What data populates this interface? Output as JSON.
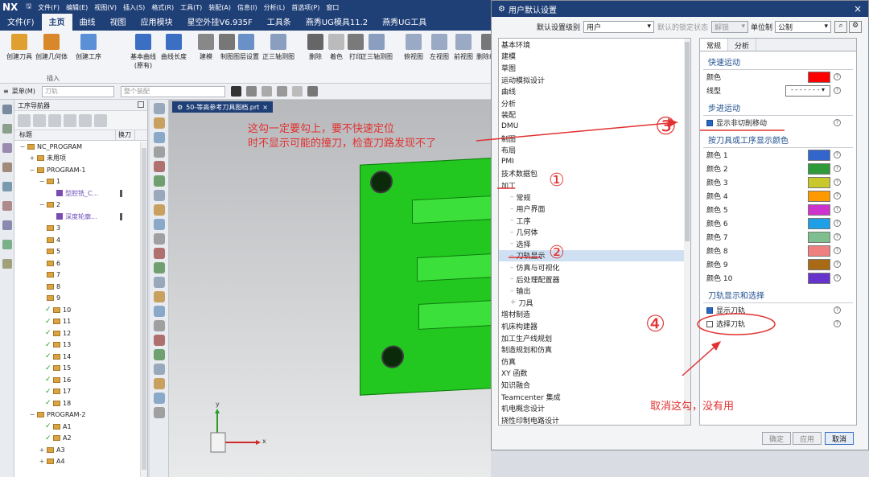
{
  "app": {
    "logo": "NX"
  },
  "menu": [
    "文件(F)",
    "编辑(E)",
    "视图(V)",
    "插入(S)",
    "格式(R)",
    "工具(T)",
    "装配(A)",
    "信息(I)",
    "分析(L)",
    "首选项(P)",
    "窗口"
  ],
  "tabs": [
    {
      "label": "文件(F)",
      "active": false
    },
    {
      "label": "主页",
      "active": true
    },
    {
      "label": "曲线",
      "active": false
    },
    {
      "label": "视图",
      "active": false
    },
    {
      "label": "应用模块",
      "active": false
    },
    {
      "label": "星空外挂V6.935F",
      "active": false
    },
    {
      "label": "工具条",
      "active": false
    },
    {
      "label": "燕秀UG模具11.2",
      "active": false
    },
    {
      "label": "燕秀UG工具",
      "active": false
    }
  ],
  "ribbon": {
    "buttons": [
      "创建刀具",
      "创建几何体",
      "创建工序",
      "基本曲线\n(原有)",
      "曲线长度",
      "建模",
      "制图",
      "图层设置",
      "正三轴测图",
      "删除",
      "着色",
      "打印",
      "正三轴测图",
      "俯视图",
      "左视图",
      "前视图",
      "删除组件"
    ],
    "group_label": "插入"
  },
  "toolbar2": {
    "menu_label": "菜单(M)",
    "filter_placeholder": "刀轨",
    "assembly_placeholder": "整个装配"
  },
  "navigator": {
    "title": "工序导航器",
    "columns": [
      "标题",
      "换刀"
    ],
    "rows": [
      {
        "indent": 0,
        "exp": "−",
        "icon": "folder",
        "label": "NC_PROGRAM",
        "mark": ""
      },
      {
        "indent": 1,
        "exp": "+",
        "icon": "folder",
        "label": "未用项",
        "mark": ""
      },
      {
        "indent": 1,
        "exp": "−",
        "icon": "folder",
        "label": "PROGRAM-1",
        "mark": ""
      },
      {
        "indent": 2,
        "exp": "−",
        "icon": "folder",
        "label": "1",
        "mark": ""
      },
      {
        "indent": 3,
        "exp": "",
        "icon": "op",
        "label": "型腔铣_C...",
        "mark": "tool",
        "purple": true
      },
      {
        "indent": 2,
        "exp": "−",
        "icon": "folder",
        "label": "2",
        "mark": ""
      },
      {
        "indent": 3,
        "exp": "",
        "icon": "op",
        "label": "深度轮廓...",
        "mark": "tool",
        "purple": true
      },
      {
        "indent": 2,
        "exp": "",
        "icon": "folder",
        "label": "3",
        "mark": ""
      },
      {
        "indent": 2,
        "exp": "",
        "icon": "folder",
        "label": "4",
        "mark": ""
      },
      {
        "indent": 2,
        "exp": "",
        "icon": "folder",
        "label": "5",
        "mark": ""
      },
      {
        "indent": 2,
        "exp": "",
        "icon": "folder",
        "label": "6",
        "mark": ""
      },
      {
        "indent": 2,
        "exp": "",
        "icon": "folder",
        "label": "7",
        "mark": ""
      },
      {
        "indent": 2,
        "exp": "",
        "icon": "folder",
        "label": "8",
        "mark": ""
      },
      {
        "indent": 2,
        "exp": "",
        "icon": "folder",
        "label": "9",
        "mark": ""
      },
      {
        "indent": 2,
        "exp": "",
        "icon": "folder",
        "label": "10",
        "mark": "",
        "check": true
      },
      {
        "indent": 2,
        "exp": "",
        "icon": "folder",
        "label": "11",
        "mark": "",
        "check": true
      },
      {
        "indent": 2,
        "exp": "",
        "icon": "folder",
        "label": "12",
        "mark": "",
        "check": true
      },
      {
        "indent": 2,
        "exp": "",
        "icon": "folder",
        "label": "13",
        "mark": "",
        "check": true
      },
      {
        "indent": 2,
        "exp": "",
        "icon": "folder",
        "label": "14",
        "mark": "",
        "check": true
      },
      {
        "indent": 2,
        "exp": "",
        "icon": "folder",
        "label": "15",
        "mark": "",
        "check": true
      },
      {
        "indent": 2,
        "exp": "",
        "icon": "folder",
        "label": "16",
        "mark": "",
        "check": true
      },
      {
        "indent": 2,
        "exp": "",
        "icon": "folder",
        "label": "17",
        "mark": "",
        "check": true
      },
      {
        "indent": 2,
        "exp": "",
        "icon": "folder",
        "label": "18",
        "mark": "",
        "check": true
      },
      {
        "indent": 1,
        "exp": "−",
        "icon": "folder",
        "label": "PROGRAM-2",
        "mark": ""
      },
      {
        "indent": 2,
        "exp": "",
        "icon": "folder",
        "label": "A1",
        "mark": "",
        "check": true
      },
      {
        "indent": 2,
        "exp": "",
        "icon": "folder",
        "label": "A2",
        "mark": "",
        "check": true
      },
      {
        "indent": 2,
        "exp": "+",
        "icon": "folder",
        "label": "A3",
        "mark": ""
      },
      {
        "indent": 2,
        "exp": "+",
        "icon": "folder",
        "label": "A4",
        "mark": ""
      }
    ]
  },
  "viewport": {
    "tab_label": "50-等高参考刀具图档.prt",
    "axis_y": "y",
    "axis_x": "x"
  },
  "dialog": {
    "title": "用户默认设置",
    "level_label": "默认设置级别",
    "level_value": "用户",
    "lock_label": "默认的锁定状态",
    "lock_value": "解锁",
    "unit_label": "单位制",
    "unit_value": "公制",
    "categories": [
      {
        "label": "基本环境",
        "sub": false
      },
      {
        "label": "建模",
        "sub": false
      },
      {
        "label": "草图",
        "sub": false
      },
      {
        "label": "运动模拟设计",
        "sub": false
      },
      {
        "label": "曲线",
        "sub": false
      },
      {
        "label": "分析",
        "sub": false
      },
      {
        "label": "装配",
        "sub": false
      },
      {
        "label": "DMU",
        "sub": false
      },
      {
        "label": "制图",
        "sub": false
      },
      {
        "label": "布局",
        "sub": false
      },
      {
        "label": "PMI",
        "sub": false
      },
      {
        "label": "技术数据包",
        "sub": false
      },
      {
        "label": "加工",
        "sub": false
      },
      {
        "label": "常规",
        "sub": true
      },
      {
        "label": "用户界面",
        "sub": true
      },
      {
        "label": "工序",
        "sub": true
      },
      {
        "label": "几何体",
        "sub": true
      },
      {
        "label": "选择",
        "sub": true
      },
      {
        "label": "刀轨显示",
        "sub": true,
        "selected": true
      },
      {
        "label": "仿真与可视化",
        "sub": true
      },
      {
        "label": "后处理配置器",
        "sub": true
      },
      {
        "label": "输出",
        "sub": true
      },
      {
        "label": "刀具",
        "sub": true,
        "plus": true
      },
      {
        "label": "增材制造",
        "sub": false
      },
      {
        "label": "机床构建器",
        "sub": false
      },
      {
        "label": "加工生产线规划",
        "sub": false
      },
      {
        "label": "制造规划和仿真",
        "sub": false
      },
      {
        "label": "仿真",
        "sub": false
      },
      {
        "label": "XY 函数",
        "sub": false
      },
      {
        "label": "知识融合",
        "sub": false
      },
      {
        "label": "Teamcenter 集成",
        "sub": false
      },
      {
        "label": "机电概念设计",
        "sub": false
      },
      {
        "label": "挠性印制电路设计",
        "sub": false
      }
    ],
    "panel_tabs": [
      "常规",
      "分析"
    ],
    "fast_motion": {
      "title": "快速运动",
      "color_label": "颜色",
      "color": "#ff0000",
      "linetype_label": "线型"
    },
    "step_motion": {
      "title": "步进运动",
      "show_noncut_label": "显示非切削移动",
      "show_noncut": true
    },
    "tool_colors": {
      "title": "按刀具或工序显示颜色",
      "items": [
        {
          "label": "颜色 1",
          "color": "#3366cc"
        },
        {
          "label": "颜色 2",
          "color": "#2e9a3a"
        },
        {
          "label": "颜色 3",
          "color": "#c8c82a"
        },
        {
          "label": "颜色 4",
          "color": "#ff9900"
        },
        {
          "label": "颜色 5",
          "color": "#cc33cc"
        },
        {
          "label": "颜色 6",
          "color": "#1f9fe6"
        },
        {
          "label": "颜色 7",
          "color": "#7fbf8f"
        },
        {
          "label": "颜色 8",
          "color": "#f08080"
        },
        {
          "label": "颜色 9",
          "color": "#a86a14"
        },
        {
          "label": "颜色 10",
          "color": "#6633cc"
        }
      ]
    },
    "toolpath": {
      "title": "刀轨显示和选择",
      "show_label": "显示刀轨",
      "show": true,
      "select_label": "选择刀轨",
      "select": false
    },
    "buttons": {
      "ok": "确定",
      "apply": "应用",
      "cancel": "取消"
    }
  },
  "annotations": {
    "note_top": "这勾一定要勾上，要不快速定位\n时不显示可能的撞刀，检查刀路发现不了",
    "note_bottom": "取消这勾，没有用",
    "n1": "①",
    "n2": "②",
    "n3": "③",
    "n4": "④"
  }
}
